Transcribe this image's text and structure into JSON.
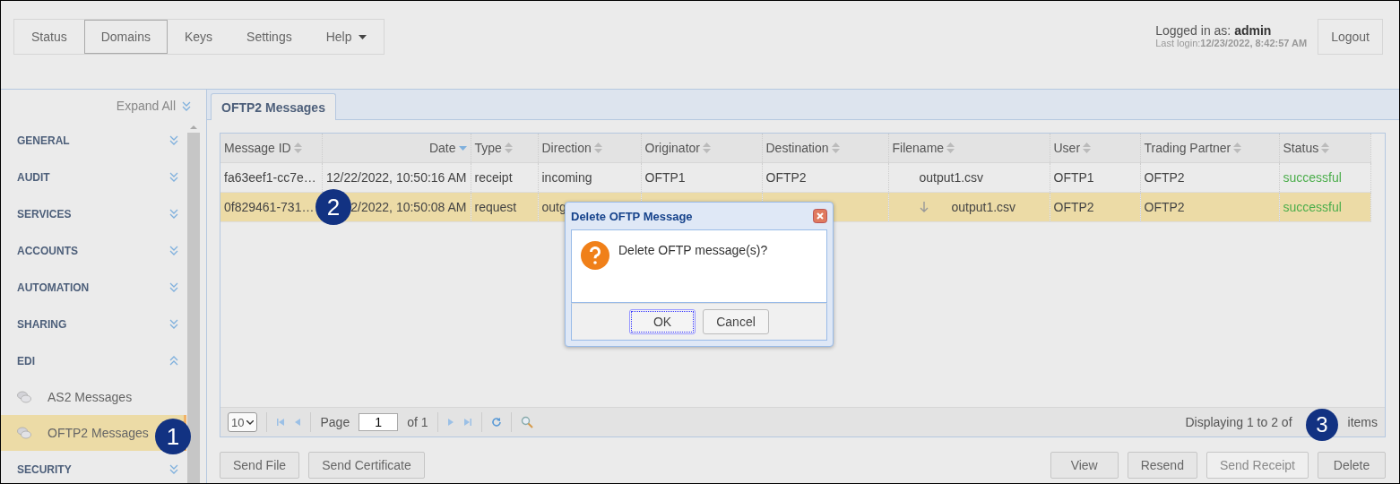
{
  "nav": {
    "items": [
      {
        "label": "Status",
        "selected": false,
        "dropdown": false
      },
      {
        "label": "Domains",
        "selected": true,
        "dropdown": false
      },
      {
        "label": "Keys",
        "selected": false,
        "dropdown": false
      },
      {
        "label": "Settings",
        "selected": false,
        "dropdown": false
      },
      {
        "label": "Help",
        "selected": false,
        "dropdown": true
      }
    ]
  },
  "user": {
    "logged_in_label": "Logged in as: ",
    "username": "admin",
    "last_login_label": "Last login:",
    "last_login": "12/23/2022, 8:42:57 AM",
    "logout": "Logout"
  },
  "sidebar": {
    "expand_all": "Expand All",
    "sections": [
      {
        "label": "GENERAL",
        "expanded": false
      },
      {
        "label": "AUDIT",
        "expanded": false
      },
      {
        "label": "SERVICES",
        "expanded": false
      },
      {
        "label": "ACCOUNTS",
        "expanded": false
      },
      {
        "label": "AUTOMATION",
        "expanded": false
      },
      {
        "label": "SHARING",
        "expanded": false
      },
      {
        "label": "EDI",
        "expanded": true,
        "children": [
          {
            "label": "AS2 Messages",
            "selected": false
          },
          {
            "label": "OFTP2 Messages",
            "selected": true
          }
        ]
      },
      {
        "label": "SECURITY",
        "expanded": false
      }
    ]
  },
  "tabs": [
    {
      "label": "OFTP2 Messages",
      "selected": true
    }
  ],
  "table": {
    "columns": [
      {
        "label": "Message ID",
        "sorted": false
      },
      {
        "label": "Date",
        "sorted": true
      },
      {
        "label": "Type",
        "sorted": false
      },
      {
        "label": "Direction",
        "sorted": false
      },
      {
        "label": "Originator",
        "sorted": false
      },
      {
        "label": "Destination",
        "sorted": false
      },
      {
        "label": "Filename",
        "sorted": false
      },
      {
        "label": "User",
        "sorted": false
      },
      {
        "label": "Trading Partner",
        "sorted": false
      },
      {
        "label": "Status",
        "sorted": false
      }
    ],
    "rows": [
      {
        "selected": false,
        "download": false,
        "cells": [
          "fa63eef1-cc7e…",
          "12/22/2022, 10:50:16 AM",
          "receipt",
          "incoming",
          "OFTP1",
          "OFTP2",
          "output1.csv",
          "OFTP1",
          "OFTP2",
          "successful"
        ]
      },
      {
        "selected": true,
        "download": true,
        "cells": [
          "0f829461-731…",
          "2/2022, 10:50:08 AM",
          "request",
          "outg",
          "",
          "",
          "output1.csv",
          "OFTP2",
          "OFTP2",
          "successful"
        ]
      }
    ]
  },
  "pager": {
    "page_size": "10",
    "page_label": "Page",
    "page": "1",
    "of_label": "of 1",
    "status_parts": [
      "Displaying 1 to 2 of",
      "items"
    ]
  },
  "left_actions": [
    {
      "label": "Send File",
      "disabled": false
    },
    {
      "label": "Send Certificate",
      "disabled": false
    }
  ],
  "right_actions": [
    {
      "label": "View",
      "disabled": false
    },
    {
      "label": "Resend",
      "disabled": false
    },
    {
      "label": "Send Receipt",
      "disabled": true
    },
    {
      "label": "Delete",
      "disabled": false
    }
  ],
  "dialog": {
    "title": "Delete OFTP Message",
    "message": "Delete OFTP message(s)?",
    "buttons": [
      {
        "label": "OK",
        "selected": true
      },
      {
        "label": "Cancel",
        "selected": false
      }
    ]
  },
  "callouts": [
    {
      "label": "1"
    },
    {
      "label": "2"
    },
    {
      "label": "3"
    }
  ]
}
